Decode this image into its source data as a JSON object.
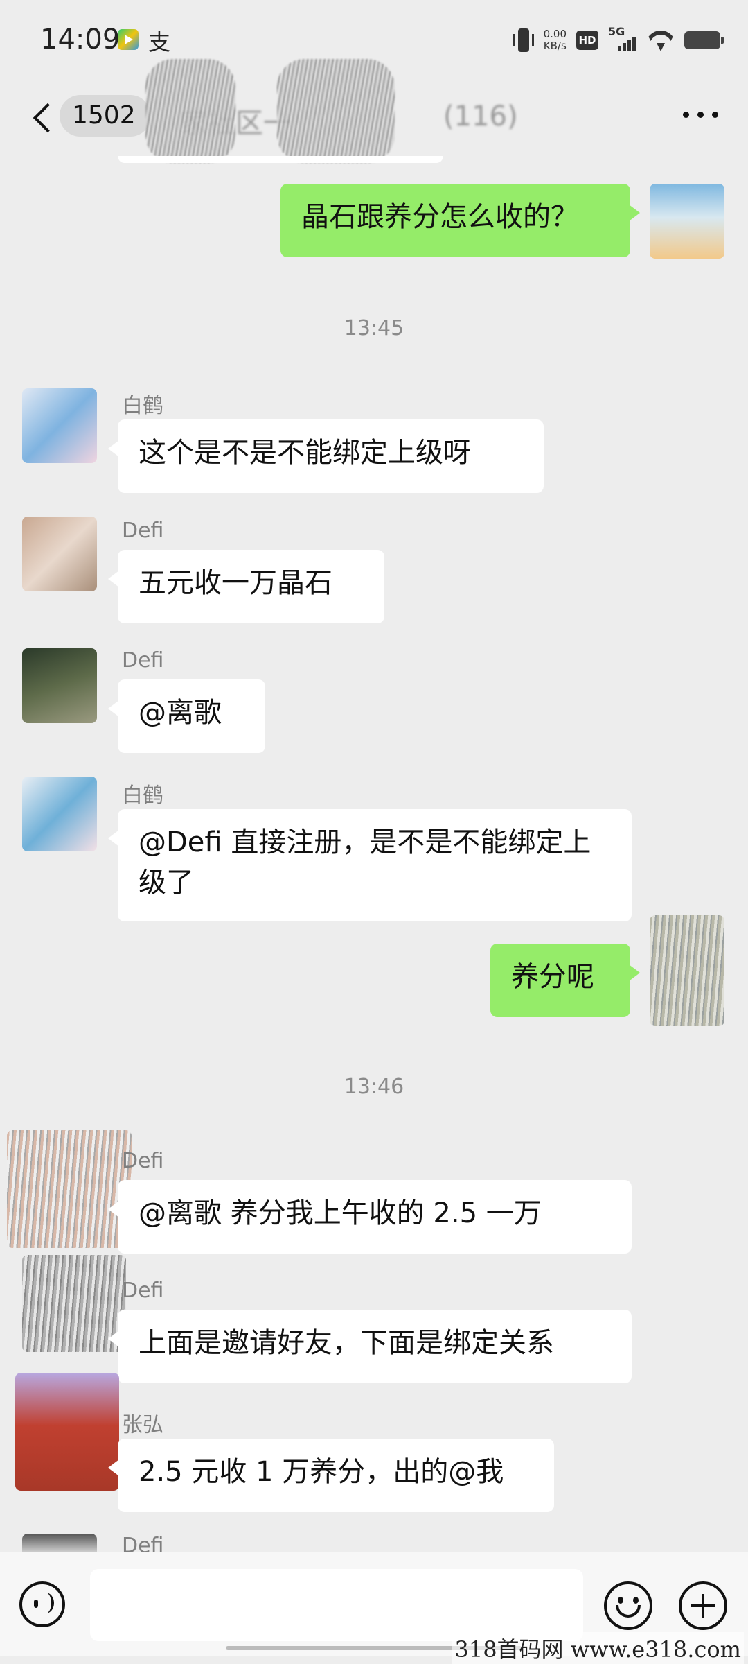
{
  "status_bar": {
    "time": "14:09",
    "notif_icon_char": "支",
    "net_speed_value": "0.00",
    "net_speed_unit": "KB/s",
    "hd_label": "HD",
    "network_label": "5G"
  },
  "header": {
    "unread_count": "1502",
    "chat_title": "家社区一",
    "member_count": "(116)"
  },
  "messages": [
    {
      "side": "right",
      "text": "晶石跟养分怎么收的？"
    },
    {
      "type": "time",
      "text": "13:45"
    },
    {
      "side": "left",
      "sender": "白鹤",
      "text": "这个是不是不能绑定上级呀"
    },
    {
      "side": "left",
      "sender": "Defi",
      "text": "五元收一万晶石"
    },
    {
      "side": "left",
      "sender": "Defi",
      "text": "@离歌"
    },
    {
      "side": "left",
      "sender": "白鹤",
      "text": "@Defi  直接注册，是不是不能绑定上级了"
    },
    {
      "side": "right",
      "text": "养分呢"
    },
    {
      "type": "time",
      "text": "13:46"
    },
    {
      "side": "left",
      "sender": "Defi",
      "text": "@离歌  养分我上午收的 2.5 一万"
    },
    {
      "side": "left",
      "sender": "Defi",
      "text": "上面是邀请好友，下面是绑定关系"
    },
    {
      "side": "left",
      "sender": "张弘",
      "text": "2.5 元收 1 万养分，出的@我"
    },
    {
      "side": "left",
      "sender": "Defi",
      "text": ""
    }
  ],
  "input": {
    "value": ""
  },
  "watermark": "318首码网 www.e318.com",
  "colors": {
    "background": "#ededed",
    "self_bubble": "#95ec69",
    "other_bubble": "#ffffff"
  },
  "icons": [
    "back-icon",
    "more-icon",
    "voice-icon",
    "emoji-icon",
    "plus-icon"
  ]
}
